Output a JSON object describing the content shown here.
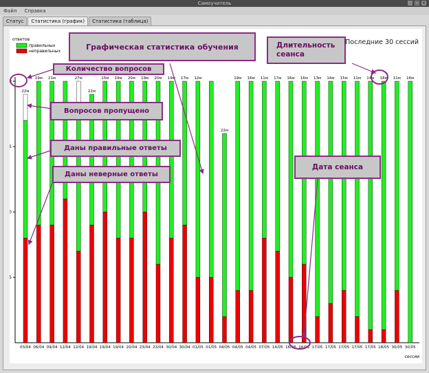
{
  "window": {
    "title": "Самоучитель"
  },
  "menu": {
    "items": [
      "Файл",
      "Справка"
    ]
  },
  "tabs": [
    {
      "label": "Статус",
      "active": false
    },
    {
      "label": "Статистика (график)",
      "active": true
    },
    {
      "label": "Статистика (таблица)",
      "active": false
    }
  ],
  "chart_header": {
    "right_title": "Последние 30 сессий"
  },
  "legend": {
    "title": "ответов",
    "items": [
      {
        "label": "правильных",
        "color": "#22ee22"
      },
      {
        "label": "неправильных",
        "color": "#ee0000"
      }
    ]
  },
  "chart_data": {
    "type": "bar",
    "stacked": true,
    "ylabel": "ответов",
    "xlabel": "сессии",
    "ylim": [
      0,
      20
    ],
    "yticks": [
      5,
      10,
      15,
      20
    ],
    "colors": {
      "wrong": "#ee0000",
      "correct": "#22ee22",
      "skipped": "#ffffff"
    },
    "series_names": {
      "correct": "правильных",
      "wrong": "неправильных"
    },
    "sessions": [
      {
        "date": "03/04",
        "wrong": 8,
        "correct": 9,
        "skipped": 2,
        "duration": "22м"
      },
      {
        "date": "06/04",
        "wrong": 9,
        "correct": 11,
        "skipped": 0,
        "duration": "19м"
      },
      {
        "date": "09/04",
        "wrong": 9,
        "correct": 11,
        "skipped": 0,
        "duration": "21м"
      },
      {
        "date": "12/04",
        "wrong": 11,
        "correct": 9,
        "skipped": 0,
        "duration": ""
      },
      {
        "date": "12/04",
        "wrong": 7,
        "correct": 11,
        "skipped": 2,
        "duration": "27м"
      },
      {
        "date": "19/04",
        "wrong": 9,
        "correct": 10,
        "skipped": 0,
        "duration": "22м"
      },
      {
        "date": "19/04",
        "wrong": 10,
        "correct": 10,
        "skipped": 0,
        "duration": "15м"
      },
      {
        "date": "19/04",
        "wrong": 8,
        "correct": 12,
        "skipped": 0,
        "duration": "19м"
      },
      {
        "date": "20/04",
        "wrong": 8,
        "correct": 12,
        "skipped": 0,
        "duration": "20м"
      },
      {
        "date": "23/04",
        "wrong": 10,
        "correct": 10,
        "skipped": 0,
        "duration": "19м"
      },
      {
        "date": "23/04",
        "wrong": 6,
        "correct": 14,
        "skipped": 0,
        "duration": "20м"
      },
      {
        "date": "30/04",
        "wrong": 8,
        "correct": 12,
        "skipped": 0,
        "duration": "19м"
      },
      {
        "date": "30/04",
        "wrong": 9,
        "correct": 11,
        "skipped": 0,
        "duration": "17м"
      },
      {
        "date": "01/05",
        "wrong": 5,
        "correct": 15,
        "skipped": 0,
        "duration": "12м"
      },
      {
        "date": "01/05",
        "wrong": 5,
        "correct": 15,
        "skipped": 0,
        "duration": ""
      },
      {
        "date": "04/05",
        "wrong": 2,
        "correct": 14,
        "skipped": 0,
        "duration": "22м"
      },
      {
        "date": "04/05",
        "wrong": 4,
        "correct": 16,
        "skipped": 0,
        "duration": "19м"
      },
      {
        "date": "04/05",
        "wrong": 4,
        "correct": 16,
        "skipped": 0,
        "duration": "16м"
      },
      {
        "date": "07/05",
        "wrong": 8,
        "correct": 12,
        "skipped": 0,
        "duration": "11м"
      },
      {
        "date": "14/05",
        "wrong": 7,
        "correct": 13,
        "skipped": 0,
        "duration": "17м"
      },
      {
        "date": "16/05",
        "wrong": 5,
        "correct": 15,
        "skipped": 0,
        "duration": "16м"
      },
      {
        "date": "16/05",
        "wrong": 6,
        "correct": 14,
        "skipped": 0,
        "duration": "16м"
      },
      {
        "date": "17/05",
        "wrong": 2,
        "correct": 18,
        "skipped": 0,
        "duration": "13м"
      },
      {
        "date": "17/05",
        "wrong": 3,
        "correct": 17,
        "skipped": 0,
        "duration": "14м"
      },
      {
        "date": "17/05",
        "wrong": 4,
        "correct": 16,
        "skipped": 0,
        "duration": "15м"
      },
      {
        "date": "17/05",
        "wrong": 2,
        "correct": 18,
        "skipped": 0,
        "duration": "11м"
      },
      {
        "date": "17/05",
        "wrong": 1,
        "correct": 19,
        "skipped": 0,
        "duration": "14м"
      },
      {
        "date": "18/05",
        "wrong": 1,
        "correct": 19,
        "skipped": 0,
        "duration": "18м"
      },
      {
        "date": "30/05",
        "wrong": 4,
        "correct": 16,
        "skipped": 0,
        "duration": "11м"
      },
      {
        "date": "30/05",
        "wrong": 0,
        "correct": 20,
        "skipped": 0,
        "duration": "16м"
      }
    ]
  },
  "annotations": {
    "main": "Графическая статистика обучения",
    "question_count": "Количество вопросов",
    "duration": "Длительность сеанса",
    "skipped": "Вопросов пропущено",
    "correct": "Даны правильные ответы",
    "wrong": "Даны неверные ответы",
    "date": "Дата сеанса",
    "color": "#8a2c86"
  }
}
